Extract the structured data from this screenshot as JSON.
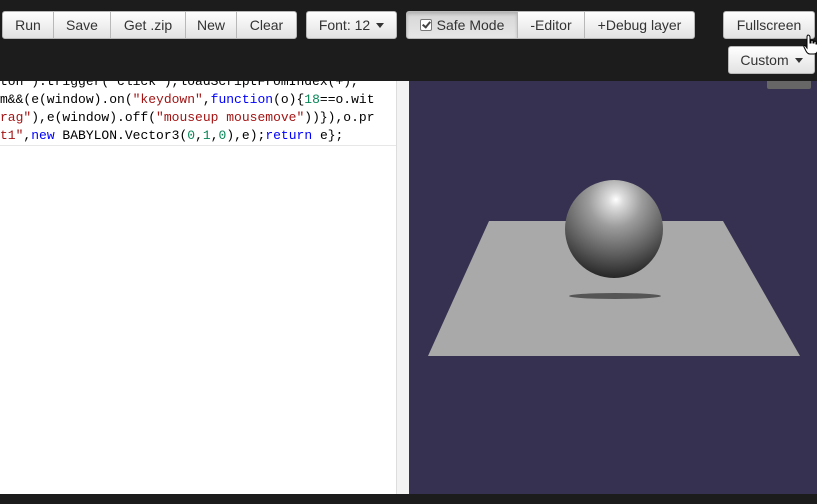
{
  "toolbar": {
    "run": "Run",
    "save": "Save",
    "get_zip": "Get .zip",
    "new": "New",
    "clear": "Clear",
    "font": "Font: 12",
    "safe_mode": "Safe Mode",
    "editor_toggle": "-Editor",
    "debug_layer": "+Debug layer",
    "fullscreen": "Fullscreen",
    "custom": "Custom"
  },
  "code": {
    "line1": "ton\").trigger(\"click\"),loadScriptFromIndex(+),",
    "line2": {
      "a": "m&&(e(window).on(",
      "b": "\"keydown\"",
      "c": ",",
      "d": "function",
      "e": "(o){",
      "f": "18",
      "g": "==o.wit"
    },
    "line3": {
      "a": "rag\"",
      "b": "),e(window).off(",
      "c": "\"mouseup mousemove\"",
      "d": "))}),o.pr"
    },
    "line4": {
      "a": "t1\"",
      "b": ",",
      "c": "new",
      "d": " BABYLON.Vector3(",
      "e": "0",
      "f": ",",
      "g": "1",
      "h": ",",
      "i": "0",
      "j": "),e);",
      "k": "return",
      "l": " e};"
    }
  },
  "colors": {
    "canvas_bg": "#363150",
    "ground": "#a9a9a9",
    "sphere": "#8a8a8a"
  }
}
